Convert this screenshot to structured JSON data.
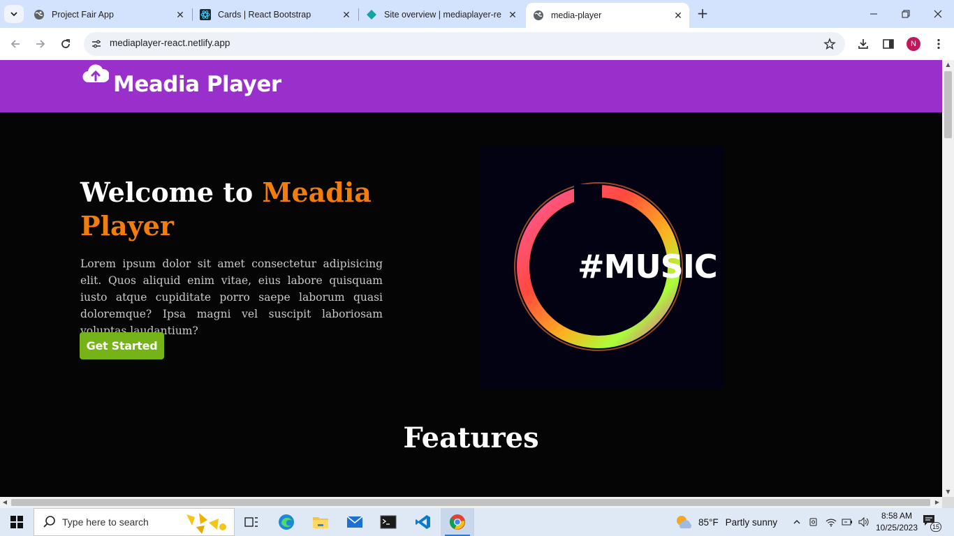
{
  "browser": {
    "tabs": [
      {
        "title": "Project Fair App",
        "icon": "globe-icon",
        "active": false
      },
      {
        "title": "Cards | React Bootstrap",
        "icon": "react-bootstrap-icon",
        "active": false
      },
      {
        "title": "Site overview | mediaplayer-re",
        "icon": "netlify-icon",
        "active": false
      },
      {
        "title": "media-player",
        "icon": "globe-icon",
        "active": true
      }
    ],
    "url": "mediaplayer-react.netlify.app",
    "profile_initial": "N",
    "close_glyph": "✕",
    "new_tab_glyph": "+"
  },
  "site": {
    "brand": "Meadia Player",
    "hero": {
      "title_prefix": "Welcome to ",
      "title_accent": "Meadia Player",
      "body": "Lorem ipsum dolor sit amet consectetur adipisicing elit. Quos aliquid enim vitae, eius labore quisquam iusto atque cupiditate porro saepe laborum quasi doloremque? Ipsa magni vel suscipit laboriosam voluptas laudantium?",
      "cta": "Get Started"
    },
    "hero_image_text": "#MUSIC",
    "features_heading": "Features",
    "colors": {
      "header": "#9a30cc",
      "accent": "#f07d0c",
      "cta": "#76b318",
      "background": "#050505"
    }
  },
  "taskbar": {
    "search_placeholder": "Type here to search",
    "weather": {
      "temp": "85°F",
      "condition": "Partly sunny"
    },
    "time": "8:58 AM",
    "date": "10/25/2023",
    "notification_count": "15"
  }
}
